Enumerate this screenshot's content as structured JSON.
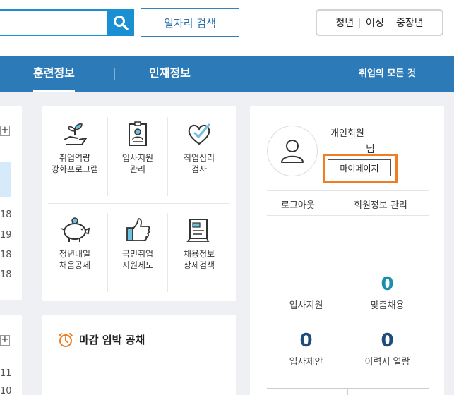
{
  "header": {
    "search_placeholder": "",
    "job_search_label": "일자리 검색",
    "quick_links": [
      "청년",
      "여성",
      "중장년"
    ]
  },
  "nav": {
    "items": [
      "훈련정보",
      "인재정보"
    ],
    "all_label": "취업의 모든 것"
  },
  "left_panel": {
    "numbers_top": [
      "18",
      "19",
      "18",
      "18"
    ],
    "numbers_bottom": [
      "11",
      "10"
    ]
  },
  "services": [
    {
      "label": "취업역량\n강화프로그램",
      "icon": "plant-hand-icon"
    },
    {
      "label": "입사지원\n관리",
      "icon": "id-badge-icon"
    },
    {
      "label": "직업심리\n검사",
      "icon": "heart-check-icon"
    },
    {
      "label": "청년내일\n채움공제",
      "icon": "piggy-bank-icon"
    },
    {
      "label": "국민취업\n지원제도",
      "icon": "thumbs-up-icon"
    },
    {
      "label": "채용정보\n상세검색",
      "icon": "document-search-icon"
    }
  ],
  "deadline": {
    "title": "마감 임박 공채",
    "icon": "alarm-clock-icon"
  },
  "member": {
    "type": "개인회원",
    "suffix": "님",
    "mypage_label": "마이페이지",
    "logout_label": "로그아웃",
    "profile_label": "회원정보 관리",
    "stats": [
      {
        "label": "입사지원",
        "value": ""
      },
      {
        "label": "맞춤채용",
        "value": "0"
      },
      {
        "label": "입사제안",
        "value": "0"
      },
      {
        "label": "이력서 열람",
        "value": "0"
      }
    ]
  },
  "colors": {
    "accent": "#2c7bb8",
    "search": "#1a8fd1",
    "highlight": "#f07d22"
  }
}
